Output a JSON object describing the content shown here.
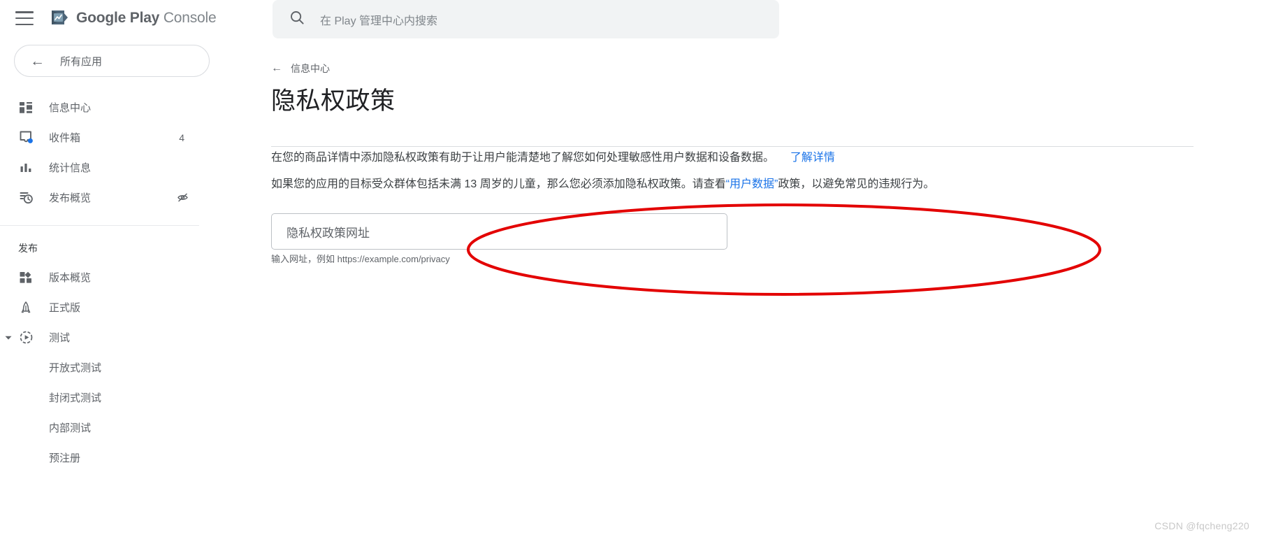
{
  "brand": {
    "logo_icon": "play-console-logo-icon",
    "menu_icon": "hamburger-menu-icon",
    "name_bold": "Google Play",
    "name_light": "Console"
  },
  "sidebar": {
    "all_apps": {
      "icon": "back-arrow-icon",
      "label": "所有应用"
    },
    "items": [
      {
        "icon": "dashboard-icon",
        "label": "信息中心",
        "badge": "",
        "trailing_icon": ""
      },
      {
        "icon": "inbox-icon",
        "label": "收件箱",
        "badge": "4",
        "trailing_icon": ""
      },
      {
        "icon": "statistics-bar-chart-icon",
        "label": "统计信息",
        "badge": "",
        "trailing_icon": ""
      },
      {
        "icon": "publishing-overview-clock-icon",
        "label": "发布概览",
        "badge": "",
        "trailing_icon": "visibility-off-icon"
      }
    ],
    "section_label": "发布",
    "publish_items": [
      {
        "icon": "release-overview-icon",
        "label": "版本概览",
        "expandable": false
      },
      {
        "icon": "production-rocket-icon",
        "label": "正式版",
        "expandable": false
      },
      {
        "icon": "testing-play-circle-icon",
        "label": "测试",
        "expandable": true
      }
    ],
    "testing_children": [
      {
        "label": "开放式测试"
      },
      {
        "label": "封闭式测试"
      },
      {
        "label": "内部测试"
      },
      {
        "label": "预注册"
      }
    ]
  },
  "search": {
    "icon": "search-icon",
    "placeholder": "在 Play 管理中心内搜索",
    "value": ""
  },
  "breadcrumb": {
    "icon": "back-arrow-icon",
    "label": "信息中心"
  },
  "page": {
    "title": "隐私权政策",
    "paragraph1": {
      "text": "在您的商品详情中添加隐私权政策有助于让用户能清楚地了解您如何处理敏感性用户数据和设备数据。",
      "link": "了解详情"
    },
    "paragraph2": {
      "before_link": "如果您的应用的目标受众群体包括未满 13 周岁的儿童，那么您必须添加隐私权政策。请查看",
      "link": "“用户数据”",
      "after_link": "政策，以避免常见的违规行为。"
    },
    "url_field": {
      "placeholder": "隐私权政策网址",
      "value": ""
    },
    "helper_text": "输入网址，例如 https://example.com/privacy"
  },
  "annotation": {
    "shape": "red-ellipse-highlight",
    "color": "#e30000"
  },
  "watermark": "CSDN @fqcheng220",
  "colors": {
    "accent_link": "#1a73e8",
    "text_primary": "#202124",
    "text_secondary": "#5f6368",
    "search_bg": "#f1f3f4",
    "border": "#dadce0",
    "annotation_red": "#e30000"
  }
}
